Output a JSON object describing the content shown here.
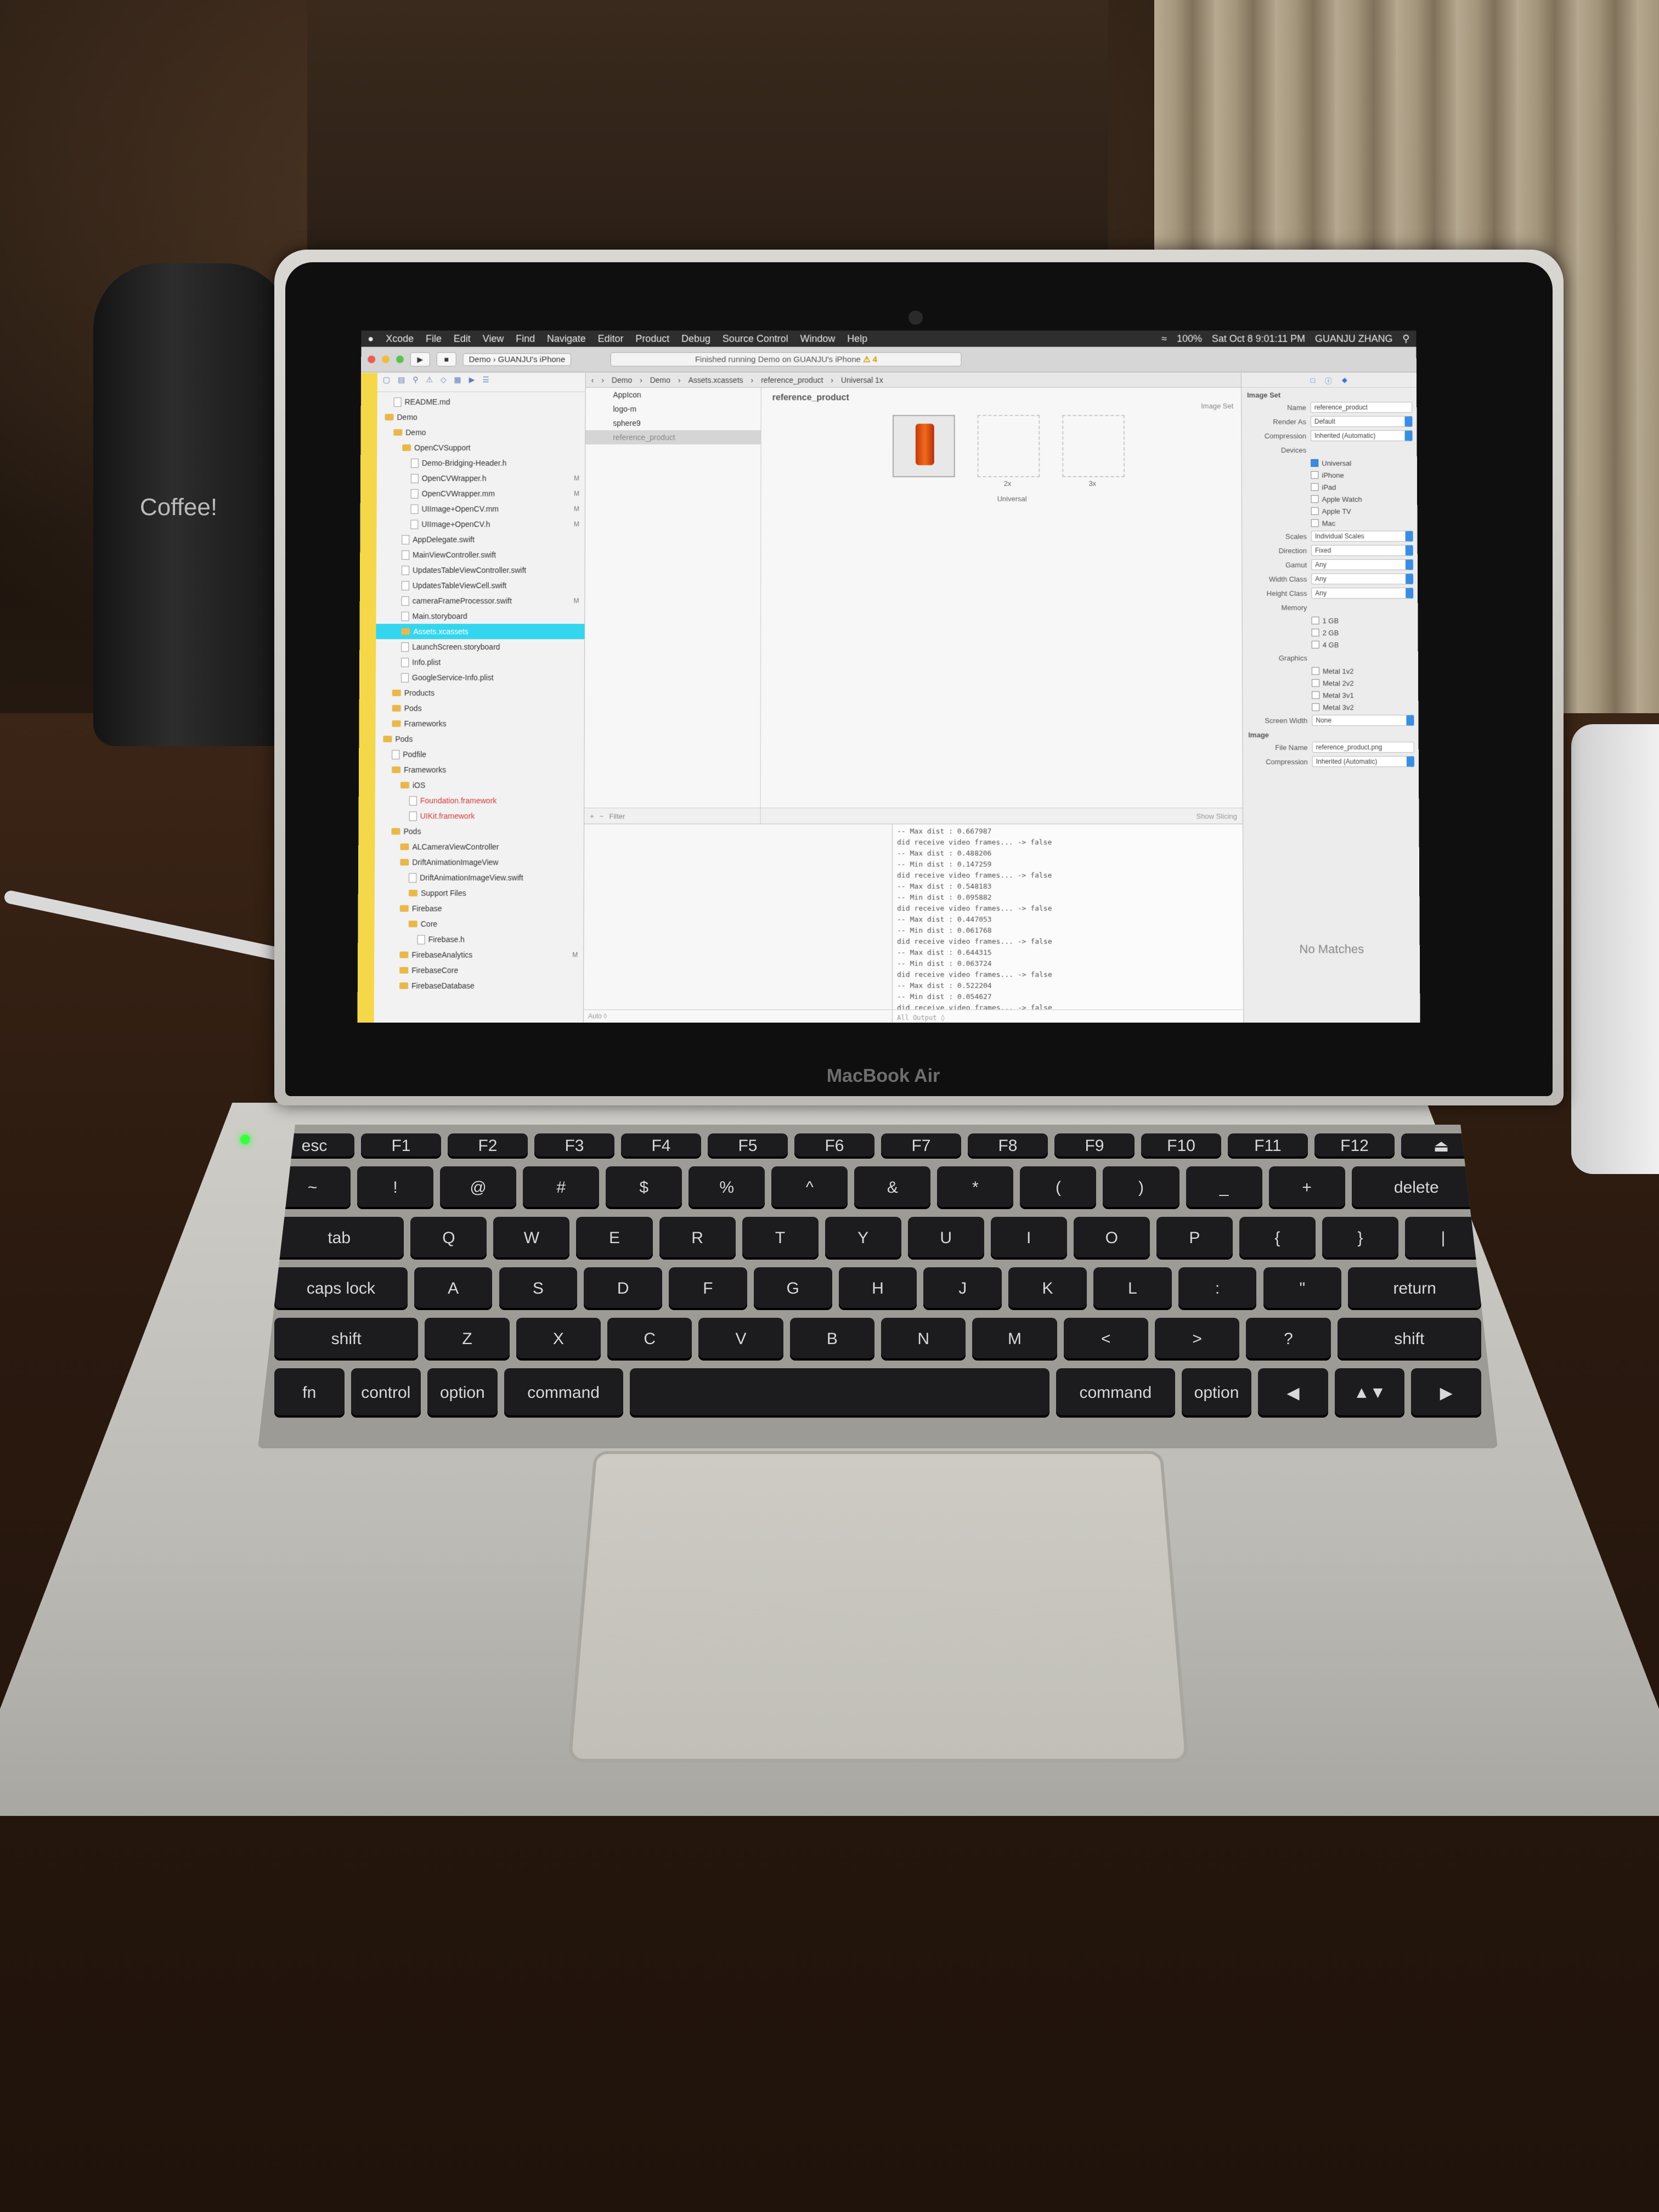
{
  "scene": {
    "bottle_label": "Coffee!",
    "brand_label": "MacBook Air"
  },
  "menubar": {
    "apple": "",
    "items": [
      "Xcode",
      "File",
      "Edit",
      "View",
      "Find",
      "Navigate",
      "Editor",
      "Product",
      "Debug",
      "Source Control",
      "Window",
      "Help"
    ],
    "battery": "100%",
    "datetime": "Sat Oct 8 9:01:11 PM",
    "user": "GUANJU ZHANG"
  },
  "toolbar": {
    "scheme": "Demo",
    "device": "GUANJU's iPhone",
    "activity": "Finished running Demo on GUANJU's iPhone",
    "warning": "⚠ 4"
  },
  "navigator": {
    "rows": [
      {
        "label": "README.md",
        "indent": 1,
        "type": "file"
      },
      {
        "label": "Demo",
        "indent": 0,
        "type": "folder"
      },
      {
        "label": "Demo",
        "indent": 1,
        "type": "folder"
      },
      {
        "label": "OpenCVSupport",
        "indent": 2,
        "type": "folder"
      },
      {
        "label": "Demo-Bridging-Header.h",
        "indent": 3,
        "type": "file"
      },
      {
        "label": "OpenCVWrapper.h",
        "indent": 3,
        "type": "file",
        "flag": "M"
      },
      {
        "label": "OpenCVWrapper.mm",
        "indent": 3,
        "type": "file",
        "flag": "M"
      },
      {
        "label": "UIImage+OpenCV.mm",
        "indent": 3,
        "type": "file",
        "flag": "M"
      },
      {
        "label": "UIImage+OpenCV.h",
        "indent": 3,
        "type": "file",
        "flag": "M"
      },
      {
        "label": "AppDelegate.swift",
        "indent": 2,
        "type": "file"
      },
      {
        "label": "MainViewController.swift",
        "indent": 2,
        "type": "file"
      },
      {
        "label": "UpdatesTableViewController.swift",
        "indent": 2,
        "type": "file"
      },
      {
        "label": "UpdatesTableViewCell.swift",
        "indent": 2,
        "type": "file"
      },
      {
        "label": "cameraFrameProcessor.swift",
        "indent": 2,
        "type": "file",
        "flag": "M"
      },
      {
        "label": "Main.storyboard",
        "indent": 2,
        "type": "file"
      },
      {
        "label": "Assets.xcassets",
        "indent": 2,
        "type": "folder",
        "selected": true
      },
      {
        "label": "LaunchScreen.storyboard",
        "indent": 2,
        "type": "file"
      },
      {
        "label": "Info.plist",
        "indent": 2,
        "type": "file"
      },
      {
        "label": "GoogleService-Info.plist",
        "indent": 2,
        "type": "file"
      },
      {
        "label": "Products",
        "indent": 1,
        "type": "folder"
      },
      {
        "label": "Pods",
        "indent": 1,
        "type": "folder"
      },
      {
        "label": "Frameworks",
        "indent": 1,
        "type": "folder"
      },
      {
        "label": "Pods",
        "indent": 0,
        "type": "folder"
      },
      {
        "label": "Podfile",
        "indent": 1,
        "type": "file"
      },
      {
        "label": "Frameworks",
        "indent": 1,
        "type": "folder"
      },
      {
        "label": "iOS",
        "indent": 2,
        "type": "folder"
      },
      {
        "label": "Foundation.framework",
        "indent": 3,
        "type": "file",
        "red": true
      },
      {
        "label": "UIKit.framework",
        "indent": 3,
        "type": "file",
        "red": true
      },
      {
        "label": "Pods",
        "indent": 1,
        "type": "folder"
      },
      {
        "label": "ALCameraViewController",
        "indent": 2,
        "type": "folder"
      },
      {
        "label": "DriftAnimationImageView",
        "indent": 2,
        "type": "folder"
      },
      {
        "label": "DriftAnimationImageView.swift",
        "indent": 3,
        "type": "file"
      },
      {
        "label": "Support Files",
        "indent": 3,
        "type": "folder"
      },
      {
        "label": "Firebase",
        "indent": 2,
        "type": "folder"
      },
      {
        "label": "Core",
        "indent": 3,
        "type": "folder"
      },
      {
        "label": "Firebase.h",
        "indent": 4,
        "type": "file"
      },
      {
        "label": "FirebaseAnalytics",
        "indent": 2,
        "type": "folder",
        "flag": "M"
      },
      {
        "label": "FirebaseCore",
        "indent": 2,
        "type": "folder"
      },
      {
        "label": "FirebaseDatabase",
        "indent": 2,
        "type": "folder"
      }
    ]
  },
  "jumpbar": [
    "Demo",
    "Demo",
    "Assets.xcassets",
    "reference_product",
    "Universal 1x"
  ],
  "assets": {
    "items": [
      "AppIcon",
      "logo-m",
      "sphere9",
      "reference_product"
    ],
    "selected_index": 3,
    "filter_placeholder": "Filter"
  },
  "canvas": {
    "title": "reference_product",
    "set_label": "Image Set",
    "slots": [
      "1x",
      "2x",
      "3x"
    ],
    "group_label": "Universal",
    "show_slicing": "Show Slicing"
  },
  "console": {
    "lines": [
      "-- Max dist : 0.667987",
      "did receive video frames... -> false",
      "-- Max dist : 0.488206",
      "-- Min dist : 0.147259",
      "did receive video frames... -> false",
      "-- Max dist : 0.548183",
      "-- Min dist : 0.095882",
      "did receive video frames... -> false",
      "-- Max dist : 0.447053",
      "-- Min dist : 0.061768",
      "did receive video frames... -> false",
      "-- Max dist : 0.644315",
      "-- Min dist : 0.063724",
      "did receive video frames... -> false",
      "-- Max dist : 0.522204",
      "-- Min dist : 0.054627",
      "did receive video frames... -> false"
    ],
    "vars_footer": "Auto ◊",
    "output_footer": "All Output ◊"
  },
  "inspector": {
    "section": "Image Set",
    "name_label": "Name",
    "name_value": "reference_product",
    "render_label": "Render As",
    "render_value": "Default",
    "compression_label": "Compression",
    "compression_value": "Inherited (Automatic)",
    "devices_label": "Devices",
    "devices": [
      {
        "label": "Universal",
        "on": true
      },
      {
        "label": "iPhone",
        "on": false
      },
      {
        "label": "iPad",
        "on": false
      },
      {
        "label": "Apple Watch",
        "on": false
      },
      {
        "label": "Apple TV",
        "on": false
      },
      {
        "label": "Mac",
        "on": false
      }
    ],
    "scales_label": "Scales",
    "scales_value": "Individual Scales",
    "direction_label": "Direction",
    "direction_value": "Fixed",
    "gamut_label": "Gamut",
    "gamut_value": "Any",
    "width_label": "Width Class",
    "width_value": "Any",
    "height_label": "Height Class",
    "height_value": "Any",
    "memory_label": "Memory",
    "memory": [
      "1 GB",
      "2 GB",
      "4 GB"
    ],
    "graphics_label": "Graphics",
    "graphics": [
      "Metal 1v2",
      "Metal 2v2",
      "Metal 3v1",
      "Metal 3v2"
    ],
    "screen_width_label": "Screen Width",
    "screen_width_value": "None",
    "image_section": "Image",
    "file_label": "File Name",
    "file_value": "reference_product.png",
    "img_compression_label": "Compression",
    "img_compression_value": "Inherited (Automatic)",
    "no_matches": "No Matches"
  },
  "keyboard": {
    "row1": [
      "esc",
      "F1",
      "F2",
      "F3",
      "F4",
      "F5",
      "F6",
      "F7",
      "F8",
      "F9",
      "F10",
      "F11",
      "F12",
      "⏏"
    ],
    "row2": [
      "~",
      "!",
      "@",
      "#",
      "$",
      "%",
      "^",
      "&",
      "*",
      "(",
      ")",
      "_",
      "+",
      "delete"
    ],
    "row3": [
      "tab",
      "Q",
      "W",
      "E",
      "R",
      "T",
      "Y",
      "U",
      "I",
      "O",
      "P",
      "{",
      "}",
      "|"
    ],
    "row4": [
      "caps lock",
      "A",
      "S",
      "D",
      "F",
      "G",
      "H",
      "J",
      "K",
      "L",
      ":",
      "\"",
      "return"
    ],
    "row5": [
      "shift",
      "Z",
      "X",
      "C",
      "V",
      "B",
      "N",
      "M",
      "<",
      ">",
      "?",
      "shift"
    ],
    "row6": [
      "fn",
      "control",
      "option",
      "command",
      "",
      "command",
      "option",
      "◀",
      "▲▼",
      "▶"
    ]
  }
}
